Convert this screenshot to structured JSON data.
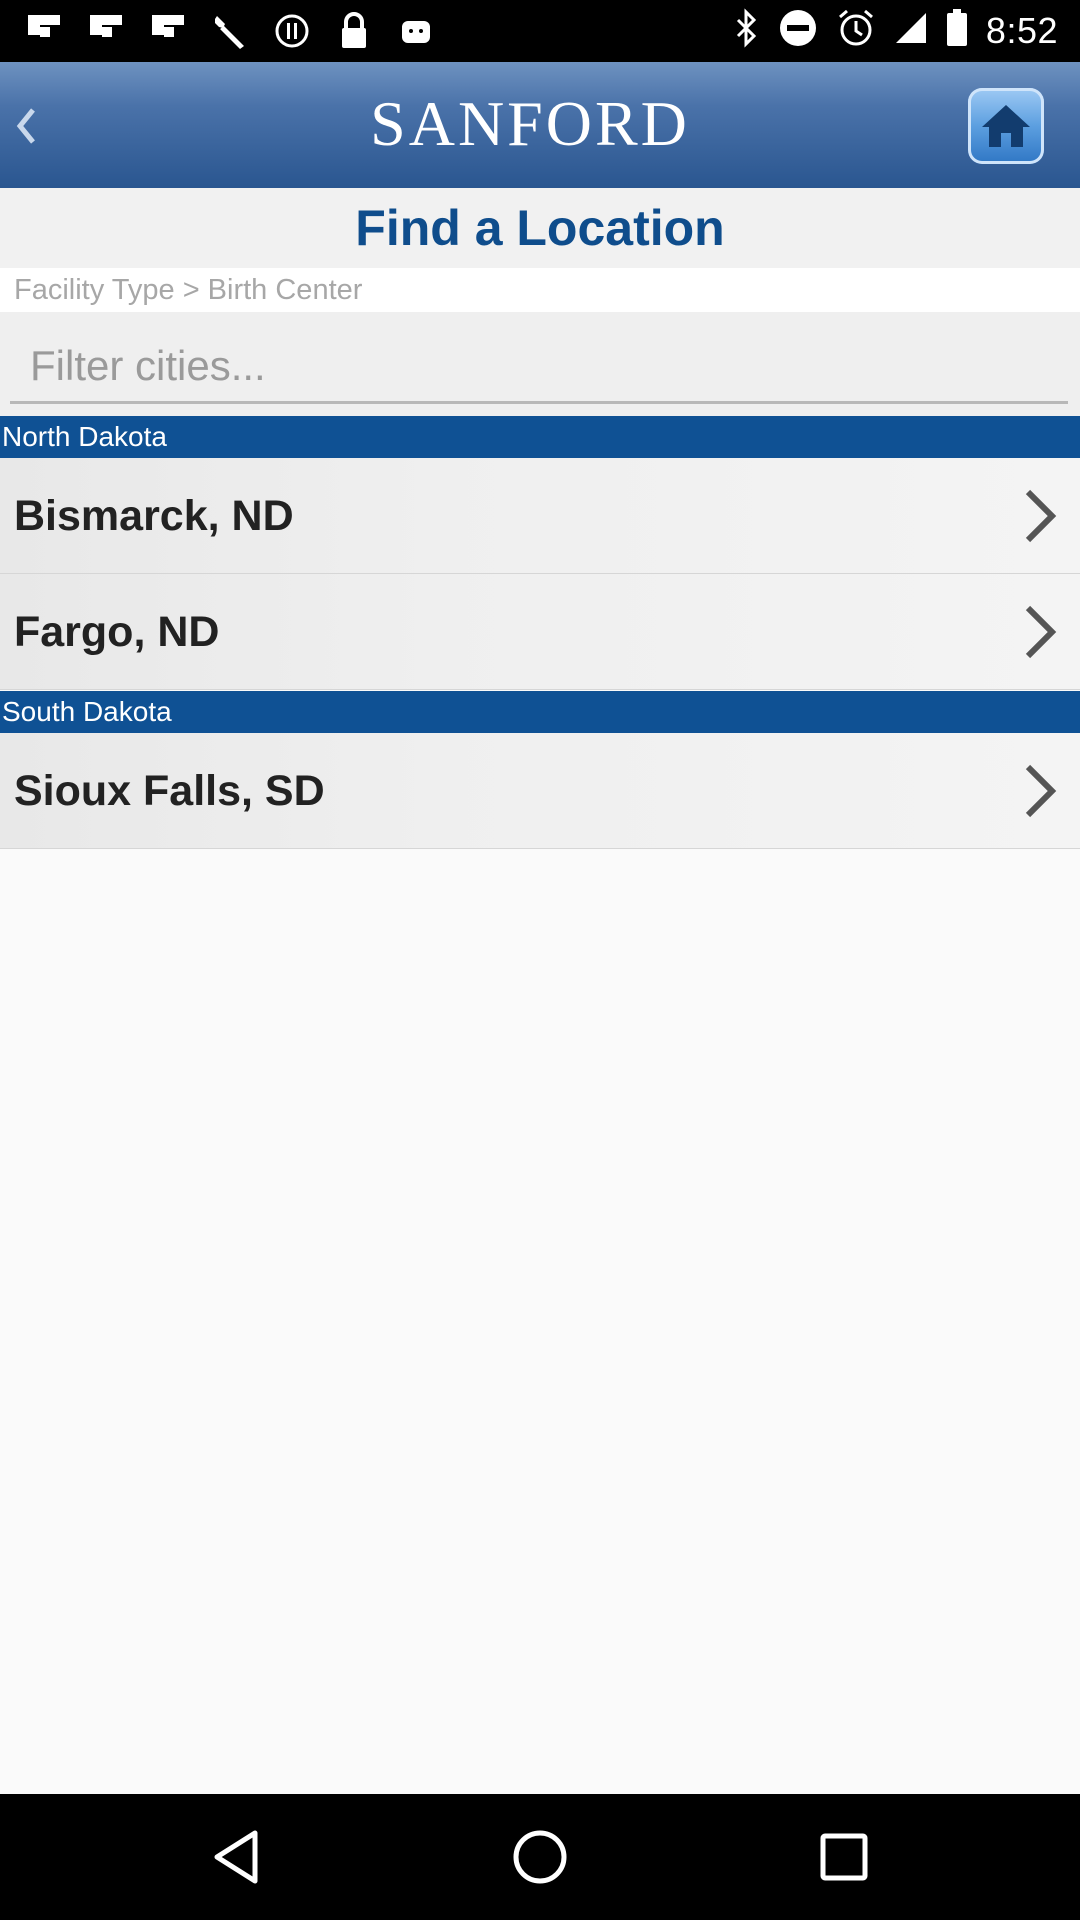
{
  "status_bar": {
    "time": "8:52",
    "icons_left": [
      "flipboard-icon",
      "flipboard-icon",
      "flipboard-icon",
      "wrench-icon",
      "alert-icon",
      "lock-icon",
      "android-icon"
    ],
    "icons_right": [
      "bluetooth-icon",
      "do-not-disturb-icon",
      "alarm-icon",
      "signal-icon",
      "battery-icon"
    ]
  },
  "header": {
    "brand": "SANFORD",
    "back_icon": "chevron-left-icon",
    "home_icon": "home-icon"
  },
  "page": {
    "title": "Find a Location",
    "breadcrumb": "Facility Type > Birth Center",
    "filter_placeholder": "Filter cities..."
  },
  "sections": [
    {
      "name": "North Dakota",
      "items": [
        {
          "label": "Bismarck, ND"
        },
        {
          "label": "Fargo, ND"
        }
      ]
    },
    {
      "name": "South Dakota",
      "items": [
        {
          "label": "Sioux Falls, SD"
        }
      ]
    }
  ],
  "nav_bar": {
    "buttons": [
      "back-icon",
      "home-circle-icon",
      "recents-icon"
    ]
  },
  "colors": {
    "brand_blue": "#0f5194",
    "title_blue": "#0f4d8c"
  }
}
